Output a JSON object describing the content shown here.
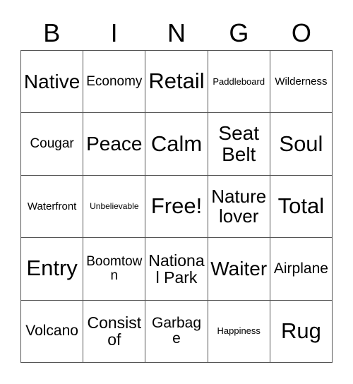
{
  "card": {
    "title_letters": [
      "B",
      "I",
      "N",
      "G",
      "O"
    ],
    "grid": {
      "rows": [
        [
          {
            "label": "Native",
            "size": "fs-xxl"
          },
          {
            "label": "Economy",
            "size": "fs-m"
          },
          {
            "label": "Retail",
            "size": "fs-3xl"
          },
          {
            "label": "Paddleboard",
            "size": "fs-s"
          },
          {
            "label": "Wilderness",
            "size": "fs-sm"
          }
        ],
        [
          {
            "label": "Cougar",
            "size": "fs-m"
          },
          {
            "label": "Peace",
            "size": "fs-xxl"
          },
          {
            "label": "Calm",
            "size": "fs-3xl"
          },
          {
            "label": "Seat Belt",
            "size": "fs-xxl"
          },
          {
            "label": "Soul",
            "size": "fs-3xl"
          }
        ],
        [
          {
            "label": "Waterfront",
            "size": "fs-sm"
          },
          {
            "label": "Unbelievable",
            "size": "fs-xs"
          },
          {
            "label": "Free!",
            "size": "fs-3xl"
          },
          {
            "label": "Nature lover",
            "size": "fs-xl"
          },
          {
            "label": "Total",
            "size": "fs-3xl"
          }
        ],
        [
          {
            "label": "Entry",
            "size": "fs-3xl"
          },
          {
            "label": "Boomtown",
            "size": "fs-m"
          },
          {
            "label": "National Park",
            "size": "fs-l"
          },
          {
            "label": "Waiter",
            "size": "fs-xxl"
          },
          {
            "label": "Airplane",
            "size": "fs-ml"
          }
        ],
        [
          {
            "label": "Volcano",
            "size": "fs-ml"
          },
          {
            "label": "Consist of",
            "size": "fs-l"
          },
          {
            "label": "Garbage",
            "size": "fs-ml"
          },
          {
            "label": "Happiness",
            "size": "fs-s"
          },
          {
            "label": "Rug",
            "size": "fs-3xl"
          }
        ]
      ]
    },
    "colors": {
      "background": "#ffffff",
      "border": "#555555",
      "text": "#000000"
    }
  }
}
